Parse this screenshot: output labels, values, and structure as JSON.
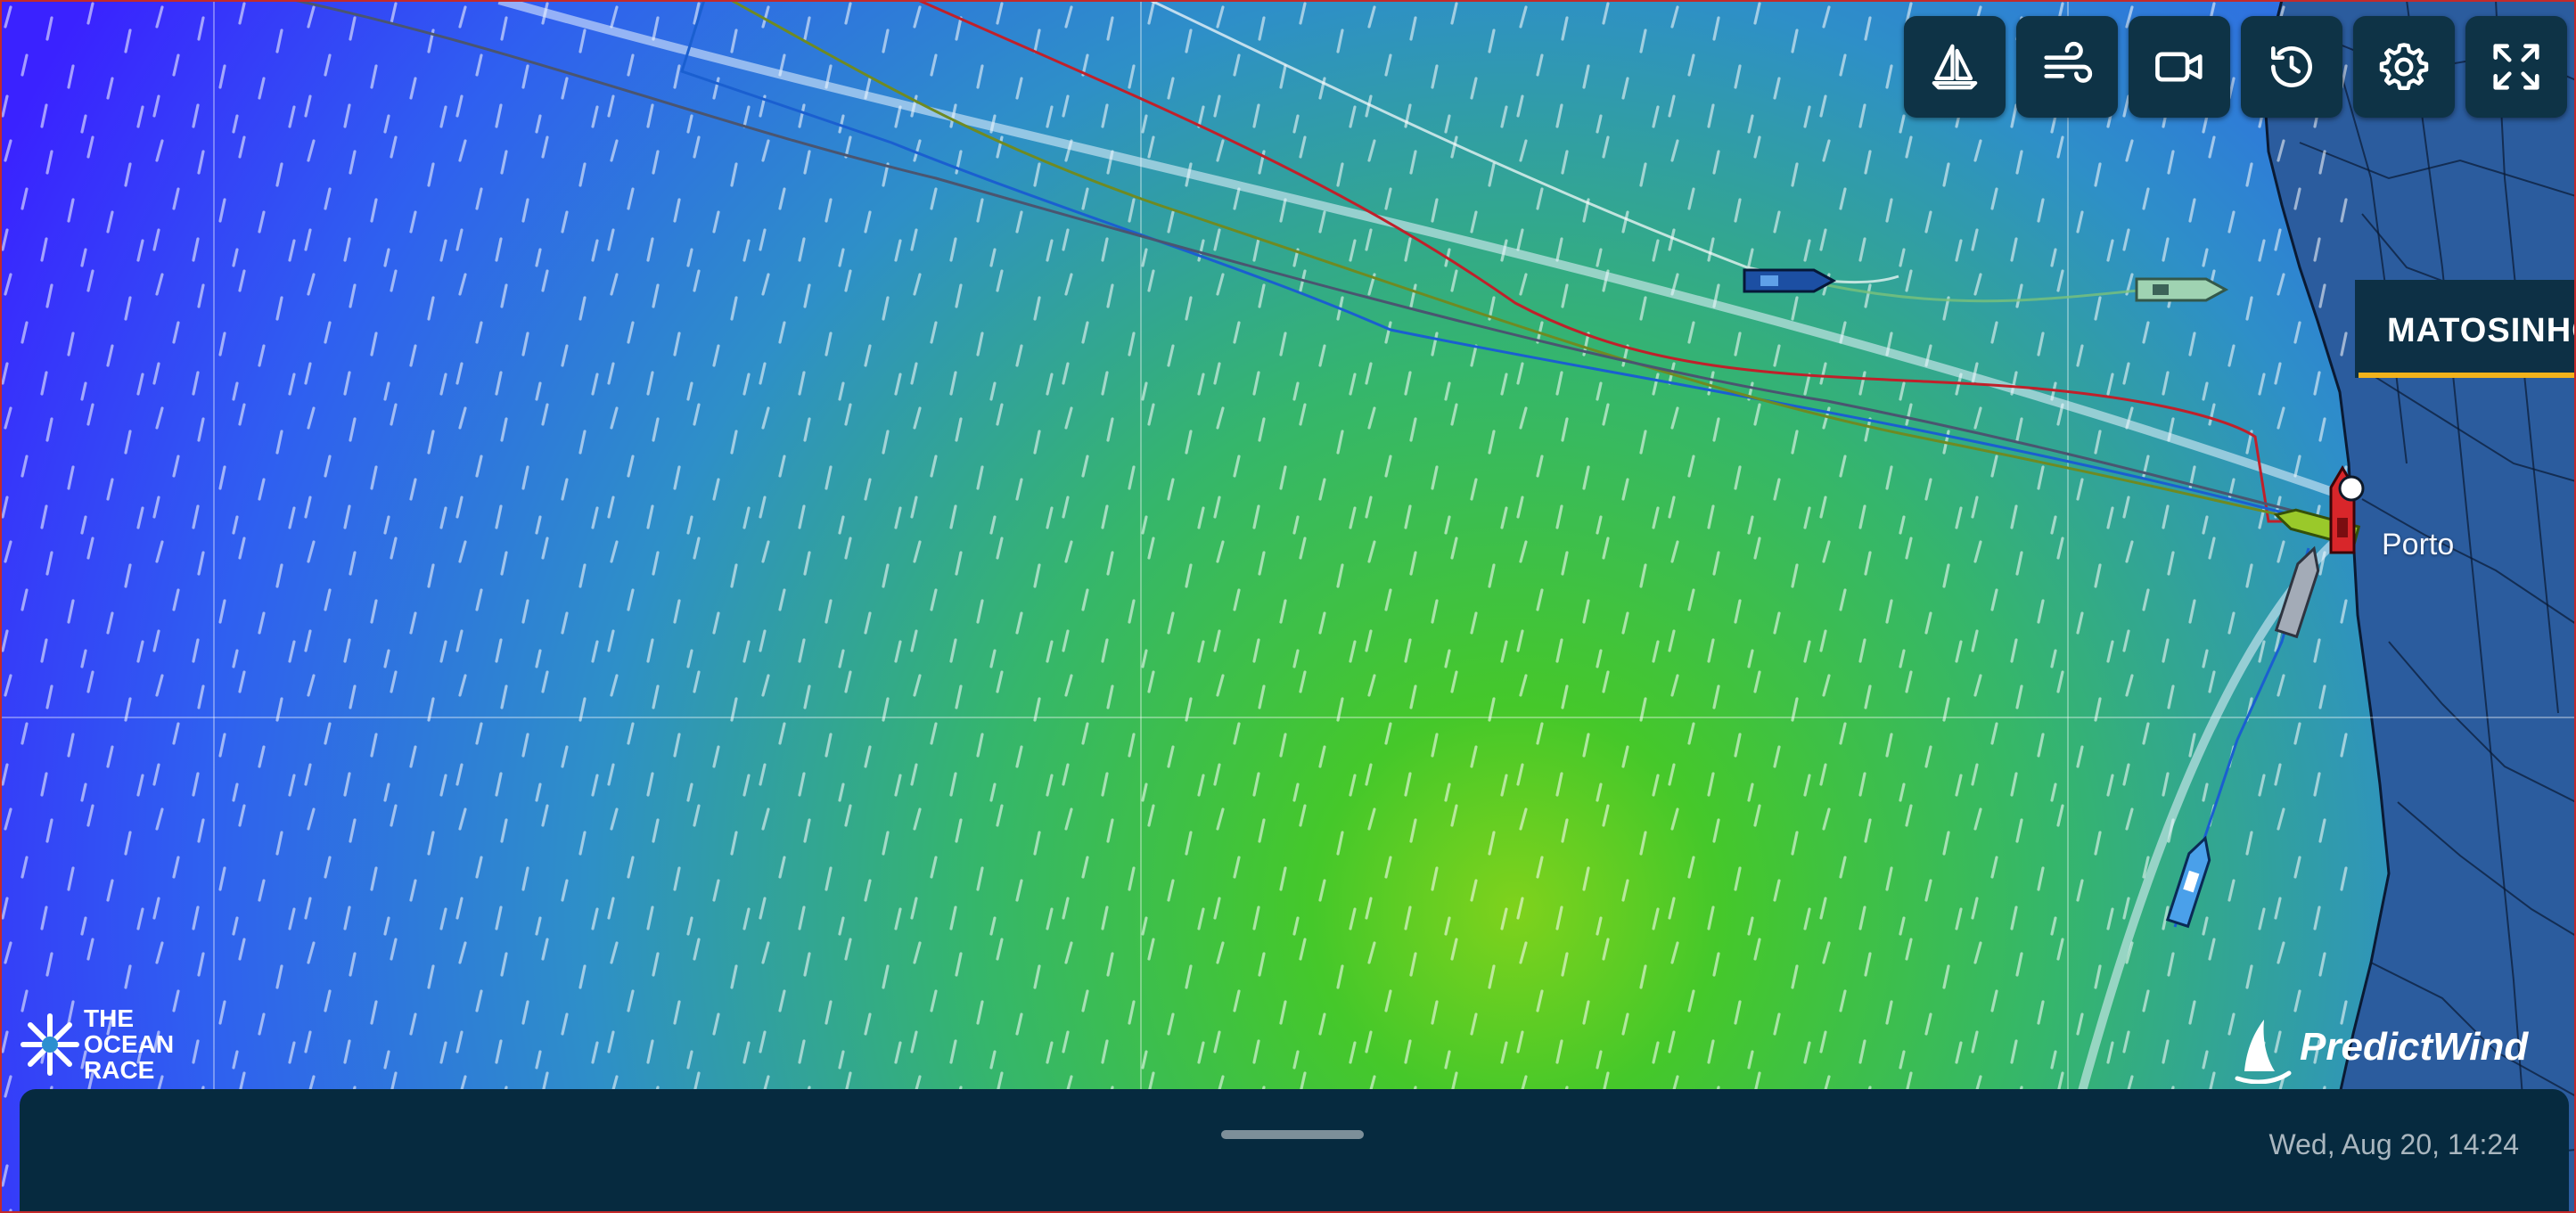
{
  "toolbar": {
    "buttons": [
      {
        "name": "fleet-button",
        "icon": "sailboat-icon"
      },
      {
        "name": "wind-button",
        "icon": "wind-icon"
      },
      {
        "name": "camera-button",
        "icon": "video-camera-icon"
      },
      {
        "name": "replay-button",
        "icon": "history-icon"
      },
      {
        "name": "settings-button",
        "icon": "gear-icon"
      },
      {
        "name": "fullscreen-button",
        "icon": "expand-icon"
      }
    ]
  },
  "map": {
    "city_label": "MATOSINHO",
    "place_label": "Porto",
    "colors": {
      "ocean_cold": "#2f3dff",
      "ocean_mid": "#2aa3a8",
      "ocean_warm": "#48c832",
      "land": "#2a5a9c",
      "accent": "#f2b21b"
    }
  },
  "logos": {
    "ocean_race": [
      "THE",
      "OCEAN",
      "RACE"
    ],
    "predictwind": "PredictWind"
  },
  "bottom_panel": {
    "datetime": "Wed, Aug 20, 14:24"
  }
}
